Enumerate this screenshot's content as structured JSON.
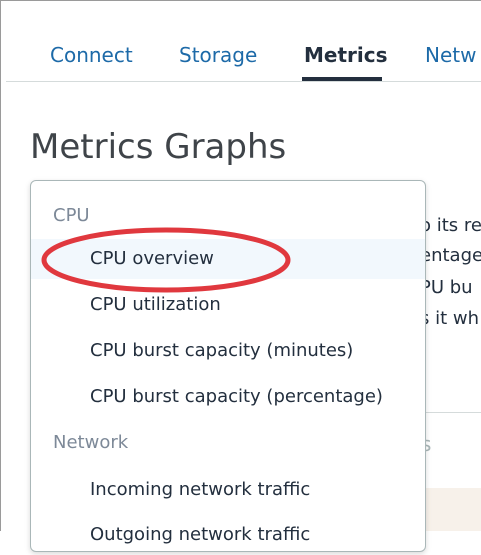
{
  "tabs": [
    {
      "label": "Connect",
      "active": false
    },
    {
      "label": "Storage",
      "active": false
    },
    {
      "label": "Metrics",
      "active": true
    },
    {
      "label": "Netw",
      "active": false
    }
  ],
  "page_title": "Metrics Graphs",
  "background_text": [
    "o its re",
    "entage",
    "PU bu",
    "s it wh",
    "s"
  ],
  "dropdown": {
    "groups": [
      {
        "label": "CPU",
        "options": [
          {
            "label": "CPU overview",
            "highlighted": true
          },
          {
            "label": "CPU utilization",
            "highlighted": false
          },
          {
            "label": "CPU burst capacity (minutes)",
            "highlighted": false
          },
          {
            "label": "CPU burst capacity (percentage)",
            "highlighted": false
          }
        ]
      },
      {
        "label": "Network",
        "options": [
          {
            "label": "Incoming network traffic",
            "highlighted": false
          },
          {
            "label": "Outgoing network traffic",
            "highlighted": false
          }
        ]
      }
    ]
  },
  "colors": {
    "link": "#1d6aa8",
    "active_tab": "#232f3e",
    "annotation": "#e0383e",
    "group_label": "#7d8998",
    "highlight": "#f2f8fd"
  }
}
